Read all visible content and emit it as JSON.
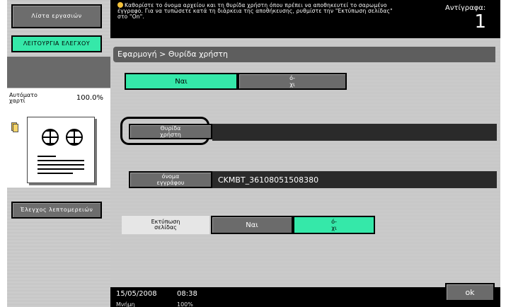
{
  "left": {
    "job_list_label": "Λίστα εργασιών",
    "check_job_label": "ΛΕΙΤΟΥΡΓΙΑ ΕΛΕΓΧΟΥ",
    "auto_paper_label": "Αυτόματο χαρτί",
    "auto_paper_percent": "100.0%",
    "check_details_label": "Έλεγχος λεπτομερειών"
  },
  "topbar": {
    "message": "Καθορίστε το όνομα αρχείου και τη θυρίδα χρήστη όπου πρέπει να αποθηκευτεί το σαρωμένο έγγραφο. Για να τυπώσετε κατά τη διάρκεια της αποθήκευσης, ρυθμίστε την \"Εκτύπωση σελίδας\" στο \"On\".",
    "copies_label": "Αντίγραφα:",
    "copies_value": "1"
  },
  "panel": {
    "breadcrumb": "Εφαρμογή > Θυρίδα χρήστη",
    "yes_label": "Ναι",
    "no_label": "ό-\nχι",
    "user_box_label": "Θυρίδα\nχρήστη",
    "user_box_value": "",
    "doc_name_label": "όνομα\nεγγράφου",
    "doc_name_value": "CKMBT_36108051508380",
    "print_page_label": "Εκτύπωση\nσελίδας",
    "print_yes_label": "Ναι",
    "print_no_label": "ό-\nχι"
  },
  "status": {
    "date": "15/05/2008",
    "time": "08:38",
    "memory_label": "Μνήμη",
    "memory_value": "100%",
    "ok_label": "ok"
  }
}
